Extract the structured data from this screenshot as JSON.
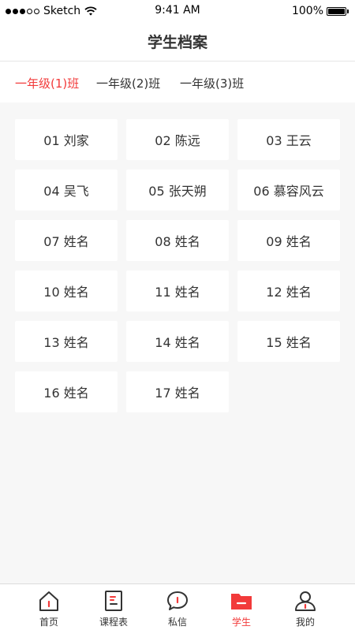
{
  "status_bar": {
    "carrier": "Sketch",
    "time": "9:41 AM",
    "battery": "100%"
  },
  "header": {
    "title": "学生档案"
  },
  "class_tabs": [
    {
      "label": "一年级(1)班",
      "active": true
    },
    {
      "label": "一年级(2)班",
      "active": false
    },
    {
      "label": "一年级(3)班",
      "active": false
    }
  ],
  "students": [
    "01 刘家",
    "02 陈远",
    "03 王云",
    "04 吴飞",
    "05 张天朔",
    "06 慕容风云",
    "07 姓名",
    "08 姓名",
    "09 姓名",
    "10 姓名",
    "11 姓名",
    "12 姓名",
    "13 姓名",
    "14 姓名",
    "15 姓名",
    "16 姓名",
    "17 姓名"
  ],
  "tab_bar": {
    "items": [
      {
        "label": "首页",
        "icon": "home-icon",
        "active": false
      },
      {
        "label": "课程表",
        "icon": "schedule-icon",
        "active": false
      },
      {
        "label": "私信",
        "icon": "message-icon",
        "active": false
      },
      {
        "label": "学生",
        "icon": "folder-icon",
        "active": true
      },
      {
        "label": "我的",
        "icon": "profile-icon",
        "active": false
      }
    ]
  },
  "colors": {
    "accent": "#f23a3a",
    "text": "#333333",
    "background": "#f7f7f7",
    "card": "#ffffff"
  }
}
